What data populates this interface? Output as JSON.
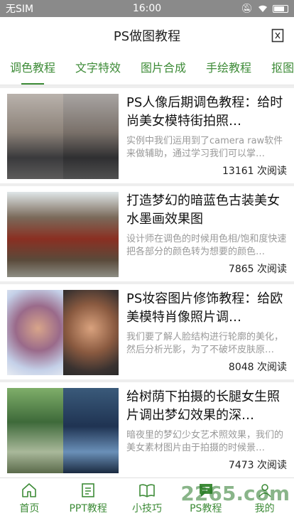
{
  "status_bar": {
    "carrier": "无SIM",
    "time": "16:00"
  },
  "header": {
    "title": "PS做图教程"
  },
  "tabs": [
    "调色教程",
    "文字特效",
    "图片合成",
    "手绘教程",
    "抠图"
  ],
  "articles": [
    {
      "title": "PS人像后期调色教程：给时尚美女模特街拍照…",
      "desc": "实例中我们运用到了camera raw软件来做辅助，通过学习我们可以掌…",
      "reads": "13161 次阅读"
    },
    {
      "title": "打造梦幻的暗蓝色古装美女水墨画效果图",
      "desc": "设计师在调色的时候用色相/饱和度快速把各部分的颜色转为想要的颜色…",
      "reads": "7865 次阅读"
    },
    {
      "title": "PS妆容图片修饰教程：给欧美模特肖像照片调…",
      "desc": "我们要了解人脸结构进行轮廓的美化，然后分析光影，为了不破坏皮肤原…",
      "reads": "8048 次阅读"
    },
    {
      "title": "给树荫下拍摄的长腿女生照片调出梦幻效果的深…",
      "desc": "暗夜里的梦幻少女艺术照效果，我们的美女素材图片由于拍摄的时候景…",
      "reads": "7473 次阅读"
    }
  ],
  "bottom_nav": [
    "首页",
    "PPT教程",
    "小技巧",
    "PS教程",
    "我的"
  ],
  "watermark": "2265.com",
  "colors": {
    "accent": "#3d8b37",
    "status_bar": "#8a8a8a"
  }
}
